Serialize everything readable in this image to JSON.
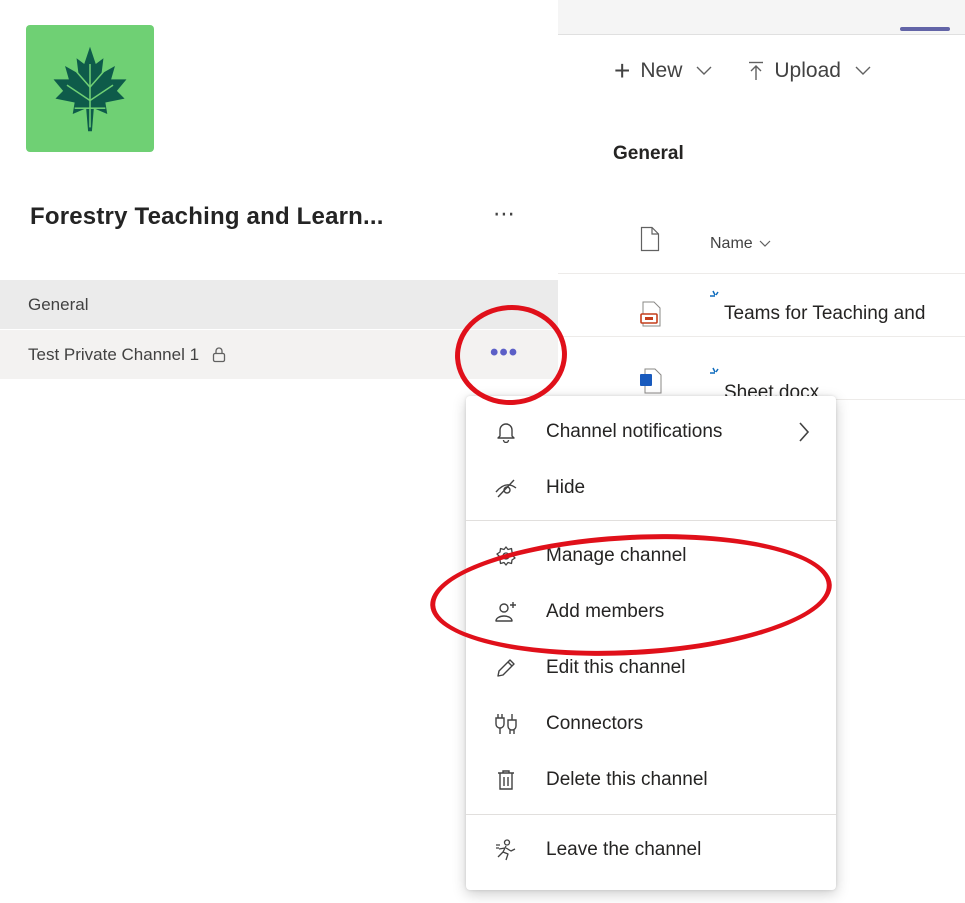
{
  "team": {
    "name": "Forestry Teaching and Learn...",
    "logo_color": "#6fd074",
    "logo_icon": "maple-leaf-icon",
    "more_label": "⋯"
  },
  "channels": [
    {
      "label": "General",
      "private": false
    },
    {
      "label": "Test Private Channel 1",
      "private": true,
      "more_label": "•••"
    }
  ],
  "toolbar": {
    "new_label": "New",
    "upload_label": "Upload"
  },
  "files": {
    "folder_title": "General",
    "name_column": "Name",
    "rows": [
      {
        "name": "Teams for Teaching and",
        "icon": "pdf-file-icon"
      },
      {
        "name": "Sheet.docx",
        "icon": "word-file-icon"
      }
    ]
  },
  "context_menu": {
    "items": [
      {
        "label": "Channel notifications",
        "icon": "bell-icon",
        "has_submenu": true
      },
      {
        "label": "Hide",
        "icon": "eye-off-icon"
      },
      {
        "label": "Manage channel",
        "icon": "gear-icon"
      },
      {
        "label": "Add members",
        "icon": "add-person-icon"
      },
      {
        "label": "Edit this channel",
        "icon": "pencil-icon"
      },
      {
        "label": "Connectors",
        "icon": "connectors-icon"
      },
      {
        "label": "Delete this channel",
        "icon": "trash-icon"
      },
      {
        "label": "Leave the channel",
        "icon": "leave-icon"
      }
    ]
  },
  "colors": {
    "accent": "#6264a7",
    "annotation": "#e0101a"
  }
}
